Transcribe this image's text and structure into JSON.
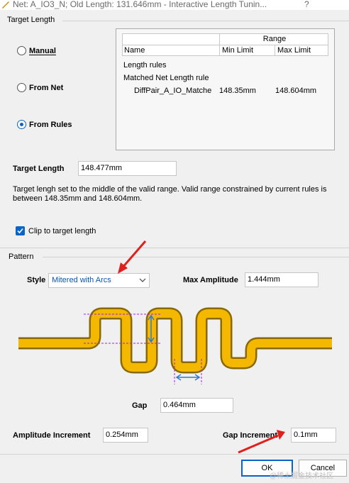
{
  "window": {
    "title": "Net: A_IO3_N;  Old Length: 131.646mm  -  Interactive Length Tunin...",
    "help": "?"
  },
  "target_length_group": {
    "title": "Target Length",
    "radios": [
      {
        "label": "Manual",
        "selected": false
      },
      {
        "label": "From Net",
        "selected": false
      },
      {
        "label": "From Rules",
        "selected": true
      }
    ],
    "range_table": {
      "range_header": "Range",
      "col_name": "Name",
      "col_min": "Min Limit",
      "col_max": "Max Limit",
      "rows": [
        {
          "name": "Length rules",
          "min": "",
          "max": ""
        },
        {
          "name": "Matched Net Length rule",
          "min": "",
          "max": ""
        },
        {
          "name": "DiffPair_A_IO_Matche",
          "min": "148.35mm",
          "max": "148.604mm"
        }
      ]
    },
    "target_length_label": "Target Length",
    "target_length_value": "148.477mm",
    "info_text": "Target lengh set to the middle of the valid range. Valid range constrained by current rules is between 148.35mm and 148.604mm.",
    "clip_label": "Clip to target length",
    "clip_checked": true
  },
  "pattern_group": {
    "title": "Pattern",
    "style_label": "Style",
    "style_value": "Mitered with Arcs",
    "max_amplitude_label": "Max Amplitude",
    "max_amplitude_value": "1.444mm",
    "gap_label": "Gap",
    "gap_value": "0.464mm",
    "amplitude_increment_label": "Amplitude Increment",
    "amplitude_increment_value": "0.254mm",
    "gap_increment_label": "Gap Increment",
    "gap_increment_value": "0.1mm"
  },
  "buttons": {
    "ok": "OK",
    "cancel": "Cancel"
  },
  "watermark": "@稀土掘金技术社区",
  "colors": {
    "accent": "#0a64c8",
    "trace": "#f5b800",
    "annotation_arrow": "#e0201b",
    "dim_line": "#a020f0"
  }
}
